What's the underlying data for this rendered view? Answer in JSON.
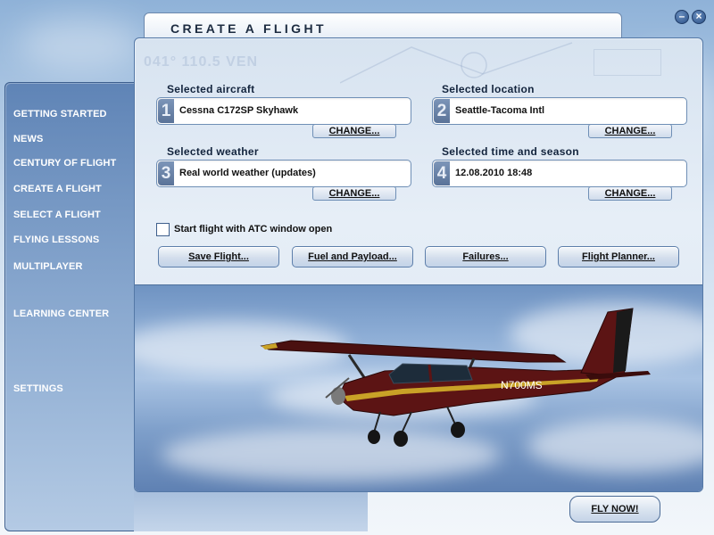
{
  "window": {
    "minimize_symbol": "–",
    "close_symbol": "×"
  },
  "nav": {
    "items": [
      {
        "label": "GETTING STARTED"
      },
      {
        "label": "NEWS"
      },
      {
        "label": "CENTURY OF FLIGHT"
      },
      {
        "label": "CREATE A FLIGHT"
      },
      {
        "label": "SELECT A FLIGHT"
      },
      {
        "label": "FLYING LESSONS"
      },
      {
        "label": "MULTIPLAYER"
      },
      {
        "label": "LEARNING CENTER"
      },
      {
        "label": "SETTINGS"
      }
    ]
  },
  "page": {
    "title": "CREATE A FLIGHT",
    "deco_heading": "041° 110.5 VEN"
  },
  "selections": {
    "aircraft": {
      "label": "Selected aircraft",
      "number": "1",
      "value": "Cessna C172SP Skyhawk",
      "change": "CHANGE..."
    },
    "location": {
      "label": "Selected location",
      "number": "2",
      "value": "Seattle-Tacoma Intl",
      "change": "CHANGE..."
    },
    "weather": {
      "label": "Selected weather",
      "number": "3",
      "value": "Real world weather (updates)",
      "change": "CHANGE..."
    },
    "time": {
      "label": "Selected time and season",
      "number": "4",
      "value": "12.08.2010 18:48",
      "change": "CHANGE..."
    }
  },
  "atc": {
    "label": "Start flight with ATC window open",
    "checked": false
  },
  "actions": {
    "save": "Save Flight...",
    "fuel": "Fuel and Payload...",
    "failures": "Failures...",
    "planner": "Flight Planner..."
  },
  "aircraft_image": {
    "registration": "N700MS"
  },
  "fly_now": "FLY NOW!",
  "colors": {
    "panel_border": "#5478a6",
    "nav_bg": "#7d9ec8",
    "aircraft_body": "#5c1414",
    "aircraft_stripe": "#c9a227"
  }
}
